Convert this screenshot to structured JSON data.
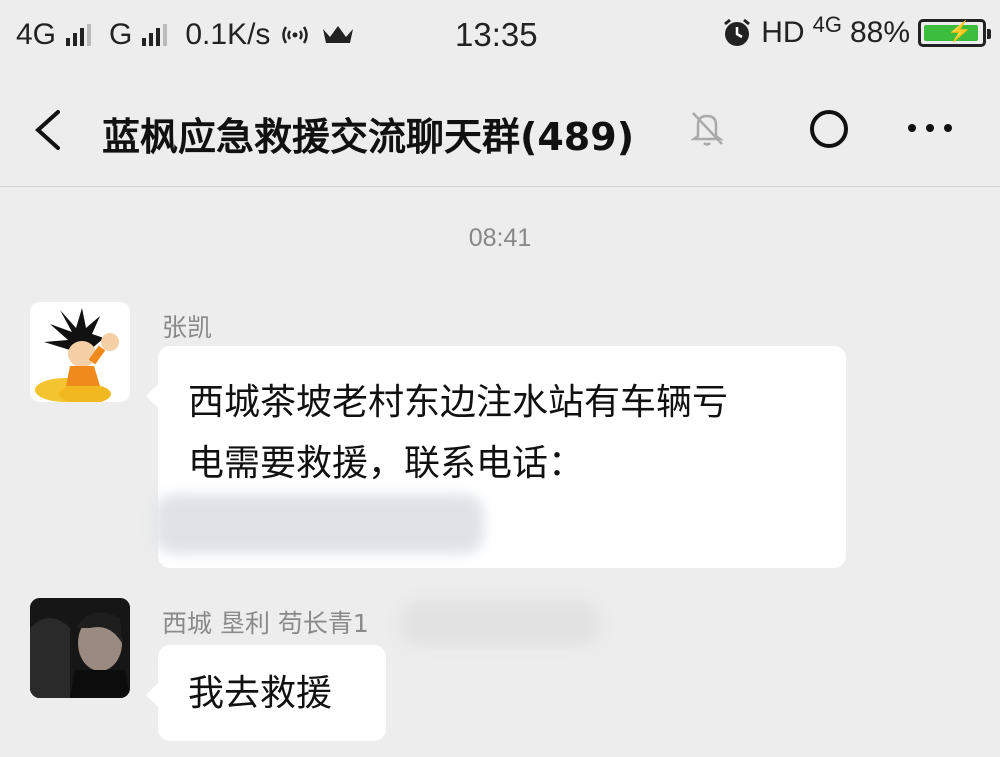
{
  "status_bar": {
    "network1": "4G",
    "network2": "G",
    "speed": "0.1K/s",
    "time": "13:35",
    "hd": "HD",
    "hd_network": "4G",
    "battery": "88%",
    "battery_color": "#3dbd3d"
  },
  "header": {
    "title": "蓝枫应急救援交流聊天群(489)"
  },
  "chat": {
    "timestamp": "08:41",
    "messages": [
      {
        "sender": "张凯",
        "lines": [
          "西城茶坡老村东边注水站有车辆亏",
          "电需要救援，联系电话："
        ]
      },
      {
        "sender": "西城 垦利 苟长青1",
        "lines": [
          "我去救援"
        ]
      }
    ]
  }
}
